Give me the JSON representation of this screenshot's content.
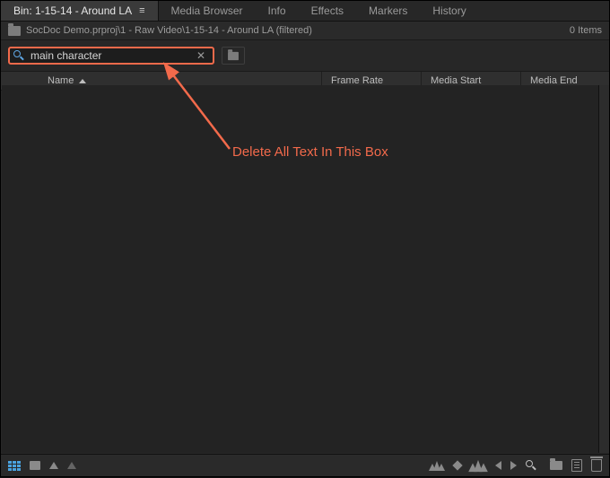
{
  "tabs": {
    "active": "Bin: 1-15-14 - Around LA",
    "others": [
      "Media Browser",
      "Info",
      "Effects",
      "Markers",
      "History"
    ]
  },
  "path": {
    "text": "SocDoc Demo.prproj\\1 - Raw Video\\1-15-14 - Around LA (filtered)",
    "item_count": "0 Items"
  },
  "search": {
    "value": "main character",
    "placeholder": ""
  },
  "columns": {
    "name": "Name",
    "frame_rate": "Frame Rate",
    "media_start": "Media Start",
    "media_end": "Media End"
  },
  "annotation": {
    "text": "Delete All Text In This Box",
    "color": "#f26a4b"
  }
}
